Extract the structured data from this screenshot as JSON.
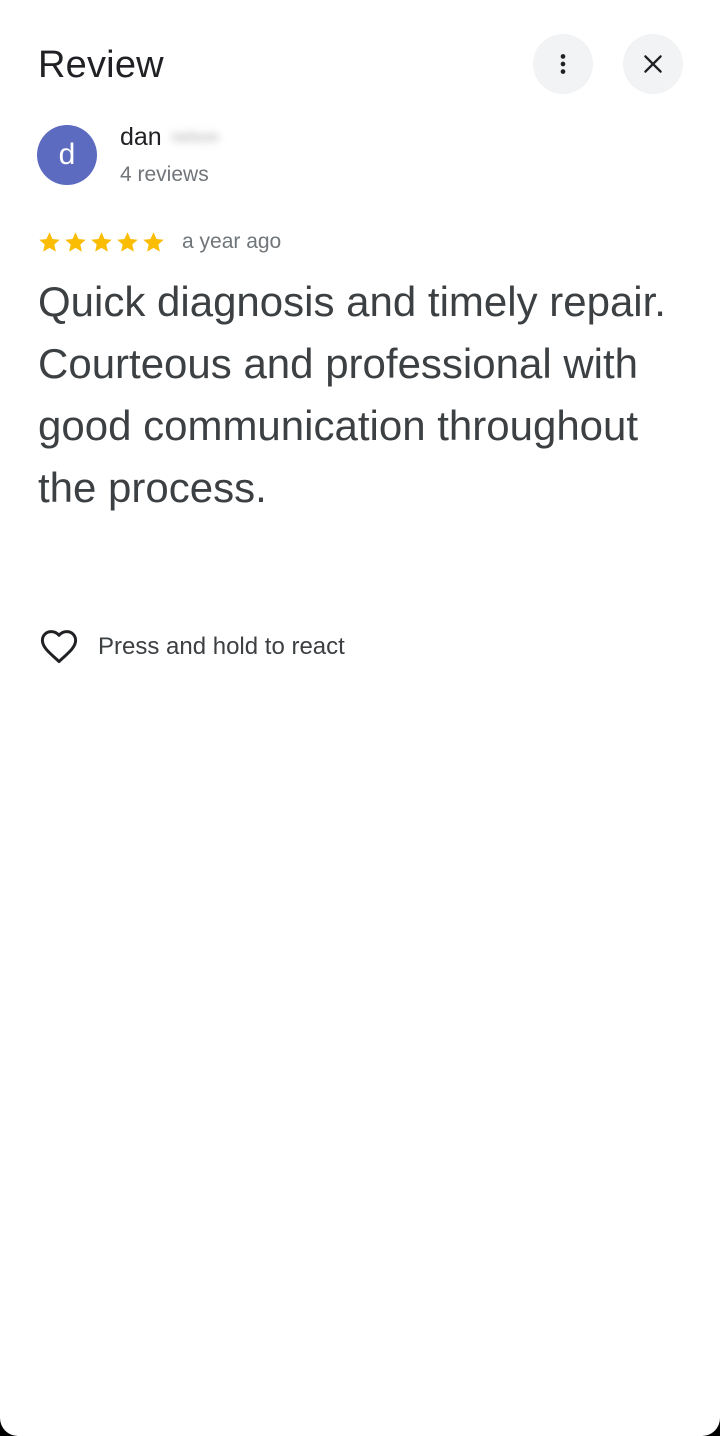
{
  "header": {
    "title": "Review",
    "more_icon": "more-vert-icon",
    "close_icon": "close-icon"
  },
  "author": {
    "initial": "d",
    "name": "dan",
    "last_name_blurred": "nelson",
    "reviews": "4 reviews",
    "avatar_color": "#5c6bc0"
  },
  "review": {
    "rating": 5,
    "max_rating": 5,
    "star_color": "#fbbc04",
    "time": "a year ago",
    "text": "Quick diagnosis and timely repair. Courteous and professional with good communication throughout the process."
  },
  "reaction": {
    "icon": "heart-outline-icon",
    "label": "Press and hold to react"
  }
}
